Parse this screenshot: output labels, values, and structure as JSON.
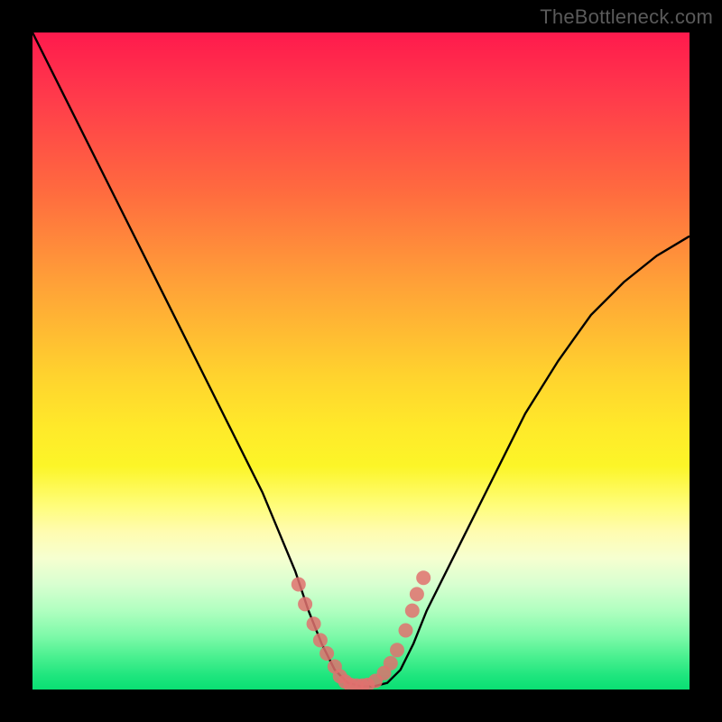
{
  "watermark": "TheBottleneck.com",
  "colors": {
    "background": "#000000",
    "curve": "#000000",
    "dot": "#e0716e",
    "gradient_top": "#ff1a4d",
    "gradient_bottom": "#0adf73"
  },
  "chart_data": {
    "type": "line",
    "title": "",
    "xlabel": "",
    "ylabel": "",
    "xlim": [
      0,
      100
    ],
    "ylim": [
      0,
      100
    ],
    "series": [
      {
        "name": "bottleneck-curve",
        "x": [
          0,
          5,
          10,
          15,
          20,
          25,
          30,
          35,
          40,
          42,
          44,
          46,
          48,
          50,
          52,
          54,
          56,
          58,
          60,
          65,
          70,
          75,
          80,
          85,
          90,
          95,
          100
        ],
        "y": [
          100,
          90,
          80,
          70,
          60,
          50,
          40,
          30,
          18,
          12,
          7,
          3,
          1,
          0.5,
          0.5,
          1,
          3,
          7,
          12,
          22,
          32,
          42,
          50,
          57,
          62,
          66,
          69
        ]
      },
      {
        "name": "highlight-dots",
        "x": [
          40.5,
          41.5,
          42.8,
          43.8,
          44.8,
          46.0,
          46.8,
          47.6,
          48.4,
          49.3,
          50.2,
          51.0,
          52.2,
          53.5,
          54.5,
          55.5,
          56.8,
          57.8,
          58.5,
          59.5
        ],
        "y": [
          16,
          13,
          10,
          7.5,
          5.5,
          3.5,
          2,
          1.2,
          0.7,
          0.6,
          0.6,
          0.7,
          1.3,
          2.5,
          4,
          6,
          9,
          12,
          14.5,
          17
        ]
      }
    ]
  }
}
